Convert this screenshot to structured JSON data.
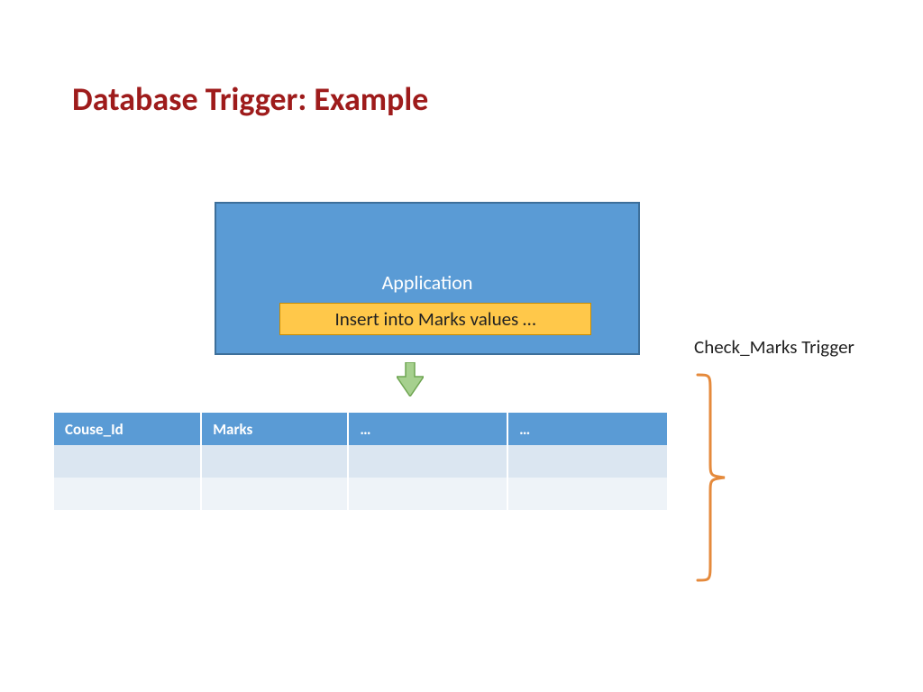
{
  "title": "Database Trigger: Example",
  "application": {
    "label": "Application",
    "statement": "Insert into Marks values …"
  },
  "table": {
    "headers": [
      "Couse_Id",
      "Marks",
      "…",
      "…"
    ],
    "rows": [
      [
        "",
        "",
        "",
        ""
      ],
      [
        "",
        "",
        "",
        ""
      ]
    ]
  },
  "trigger": {
    "label": "Check_Marks Trigger"
  }
}
